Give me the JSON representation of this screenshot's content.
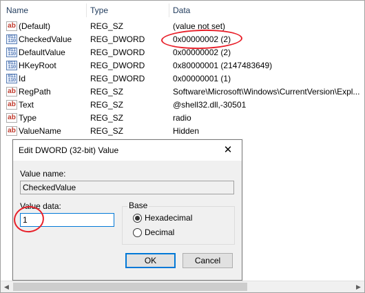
{
  "columns": {
    "name": "Name",
    "type": "Type",
    "data": "Data"
  },
  "rows": [
    {
      "icon": "string-value-icon",
      "glyph": "ab",
      "name": "(Default)",
      "type": "REG_SZ",
      "data": "(value not set)"
    },
    {
      "icon": "binary-value-icon",
      "glyph": "011\n110",
      "name": "CheckedValue",
      "type": "REG_DWORD",
      "data": "0x00000002 (2)"
    },
    {
      "icon": "binary-value-icon",
      "glyph": "011\n110",
      "name": "DefaultValue",
      "type": "REG_DWORD",
      "data": "0x00000002 (2)"
    },
    {
      "icon": "binary-value-icon",
      "glyph": "011\n110",
      "name": "HKeyRoot",
      "type": "REG_DWORD",
      "data": "0x80000001 (2147483649)"
    },
    {
      "icon": "binary-value-icon",
      "glyph": "011\n110",
      "name": "Id",
      "type": "REG_DWORD",
      "data": "0x00000001 (1)"
    },
    {
      "icon": "string-value-icon",
      "glyph": "ab",
      "name": "RegPath",
      "type": "REG_SZ",
      "data": "Software\\Microsoft\\Windows\\CurrentVersion\\Expl..."
    },
    {
      "icon": "string-value-icon",
      "glyph": "ab",
      "name": "Text",
      "type": "REG_SZ",
      "data": "@shell32.dll,-30501"
    },
    {
      "icon": "string-value-icon",
      "glyph": "ab",
      "name": "Type",
      "type": "REG_SZ",
      "data": "radio"
    },
    {
      "icon": "string-value-icon",
      "glyph": "ab",
      "name": "ValueName",
      "type": "REG_SZ",
      "data": "Hidden"
    }
  ],
  "dialog": {
    "title": "Edit DWORD (32-bit) Value",
    "close_glyph": "✕",
    "value_name_label": "Value name:",
    "value_name": "CheckedValue",
    "value_data_label": "Value data:",
    "value_data": "1",
    "base_label": "Base",
    "radio_hex": "Hexadecimal",
    "radio_dec": "Decimal",
    "base_selected": "Hexadecimal",
    "ok": "OK",
    "cancel": "Cancel"
  },
  "scrollbar": {
    "left_glyph": "◀",
    "right_glyph": "▶"
  },
  "colors": {
    "annotation": "#e8202a",
    "accent": "#0078d7"
  }
}
